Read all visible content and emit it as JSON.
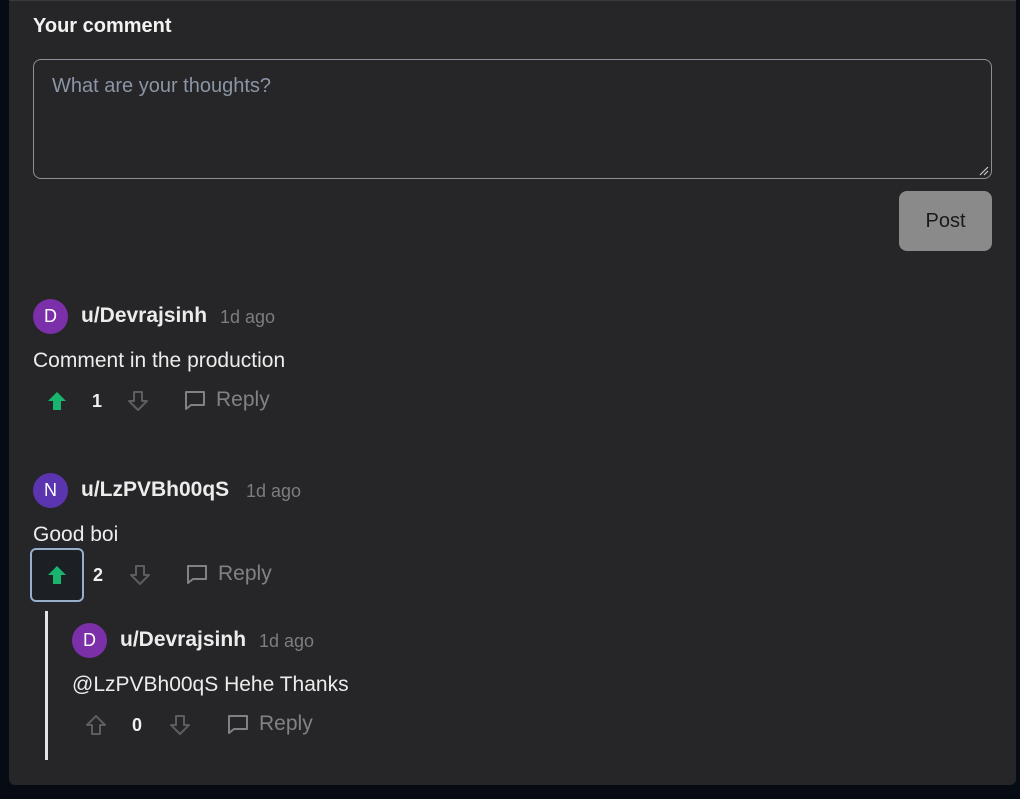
{
  "form": {
    "label": "Your comment",
    "placeholder": "What are your thoughts?",
    "post_label": "Post"
  },
  "comments": [
    {
      "avatar_letter": "D",
      "avatar_color": "#7b2fa8",
      "username": "u/Devrajsinh",
      "time": "1d ago",
      "body": "Comment in the production",
      "votes": "1",
      "upvoted": true,
      "reply_label": "Reply"
    },
    {
      "avatar_letter": "N",
      "avatar_color": "#5b34b0",
      "username": "u/LzPVBh00qS",
      "time": "1d ago",
      "body": "Good boi",
      "votes": "2",
      "upvoted": true,
      "reply_label": "Reply",
      "replies": [
        {
          "avatar_letter": "D",
          "avatar_color": "#7b2fa8",
          "username": "u/Devrajsinh",
          "time": "1d ago",
          "body": "@LzPVBh00qS Hehe Thanks",
          "votes": "0",
          "upvoted": false,
          "reply_label": "Reply"
        }
      ]
    }
  ],
  "colors": {
    "upvote_active": "#19b56e",
    "icon_inactive": "#5d5d60",
    "thread_line": "#e4e4e4"
  },
  "icons": {
    "upvote": "arrow-up-icon",
    "downvote": "arrow-down-icon",
    "reply": "comment-bubble-icon"
  }
}
